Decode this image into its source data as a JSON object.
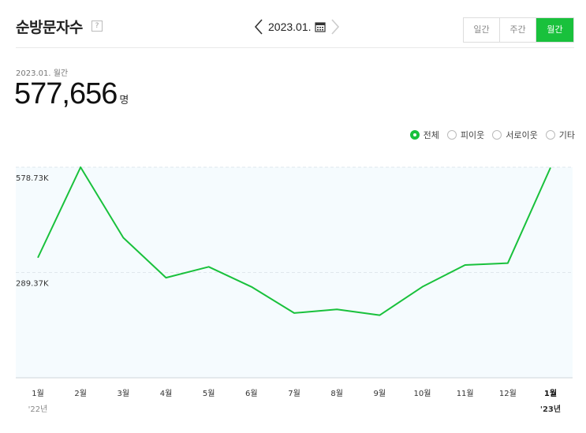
{
  "header": {
    "title": "순방문자수",
    "help_icon": "?",
    "date": "2023.01.",
    "periods": [
      {
        "label": "일간",
        "active": false
      },
      {
        "label": "주간",
        "active": false
      },
      {
        "label": "월간",
        "active": true
      }
    ]
  },
  "summary": {
    "subtitle": "2023.01. 월간",
    "value": "577,656",
    "unit": "명"
  },
  "filters": [
    {
      "label": "전체",
      "selected": true
    },
    {
      "label": "피이웃",
      "selected": false
    },
    {
      "label": "서로이웃",
      "selected": false
    },
    {
      "label": "기타",
      "selected": false
    }
  ],
  "colors": {
    "accent": "#19c13c",
    "plot_bg": "#f5fbfe",
    "line": "#19c13c"
  },
  "chart_data": {
    "type": "line",
    "title": "",
    "xlabel": "",
    "ylabel": "",
    "categories": [
      "1월",
      "2월",
      "3월",
      "4월",
      "5월",
      "6월",
      "7월",
      "8월",
      "9월",
      "10월",
      "11월",
      "12월",
      "1월"
    ],
    "year_labels": [
      "'22년",
      "",
      "",
      "",
      "",
      "",
      "",
      "",
      "",
      "",
      "",
      "",
      "'23년"
    ],
    "series": [
      {
        "values": [
          330000,
          578730,
          385000,
          275000,
          305000,
          250000,
          178000,
          188000,
          172000,
          250000,
          310000,
          315000,
          577656
        ]
      }
    ],
    "ytick_labels": [
      "578.73K",
      "289.37K"
    ],
    "ytick_values": [
      578730,
      289370
    ],
    "ylim": [
      0,
      578730
    ],
    "grid": true,
    "legend": "none"
  }
}
